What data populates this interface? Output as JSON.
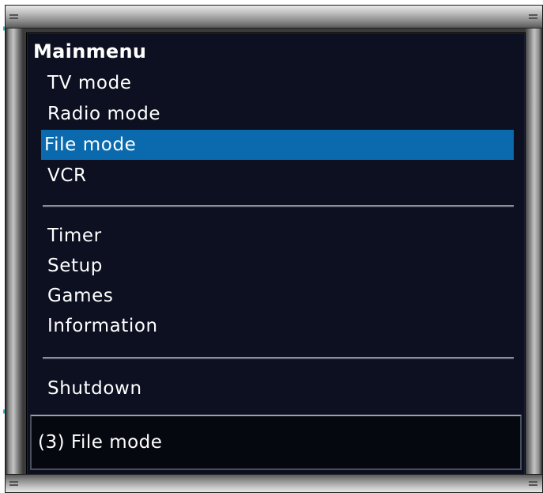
{
  "menu": {
    "title": "Mainmenu",
    "group1": [
      {
        "label": "TV mode"
      },
      {
        "label": "Radio mode"
      },
      {
        "label": "File mode",
        "selected": true
      },
      {
        "label": "VCR"
      }
    ],
    "group2": [
      {
        "label": "Timer"
      },
      {
        "label": "Setup"
      },
      {
        "label": "Games"
      },
      {
        "label": "Information"
      }
    ],
    "group3": [
      {
        "label": "Shutdown"
      }
    ]
  },
  "status": {
    "text": "(3) File mode"
  },
  "colors": {
    "panel_bg": "#0c1020",
    "selection": "#0a6aad",
    "bracket": "#2bbcc0",
    "text": "#ffffff"
  }
}
